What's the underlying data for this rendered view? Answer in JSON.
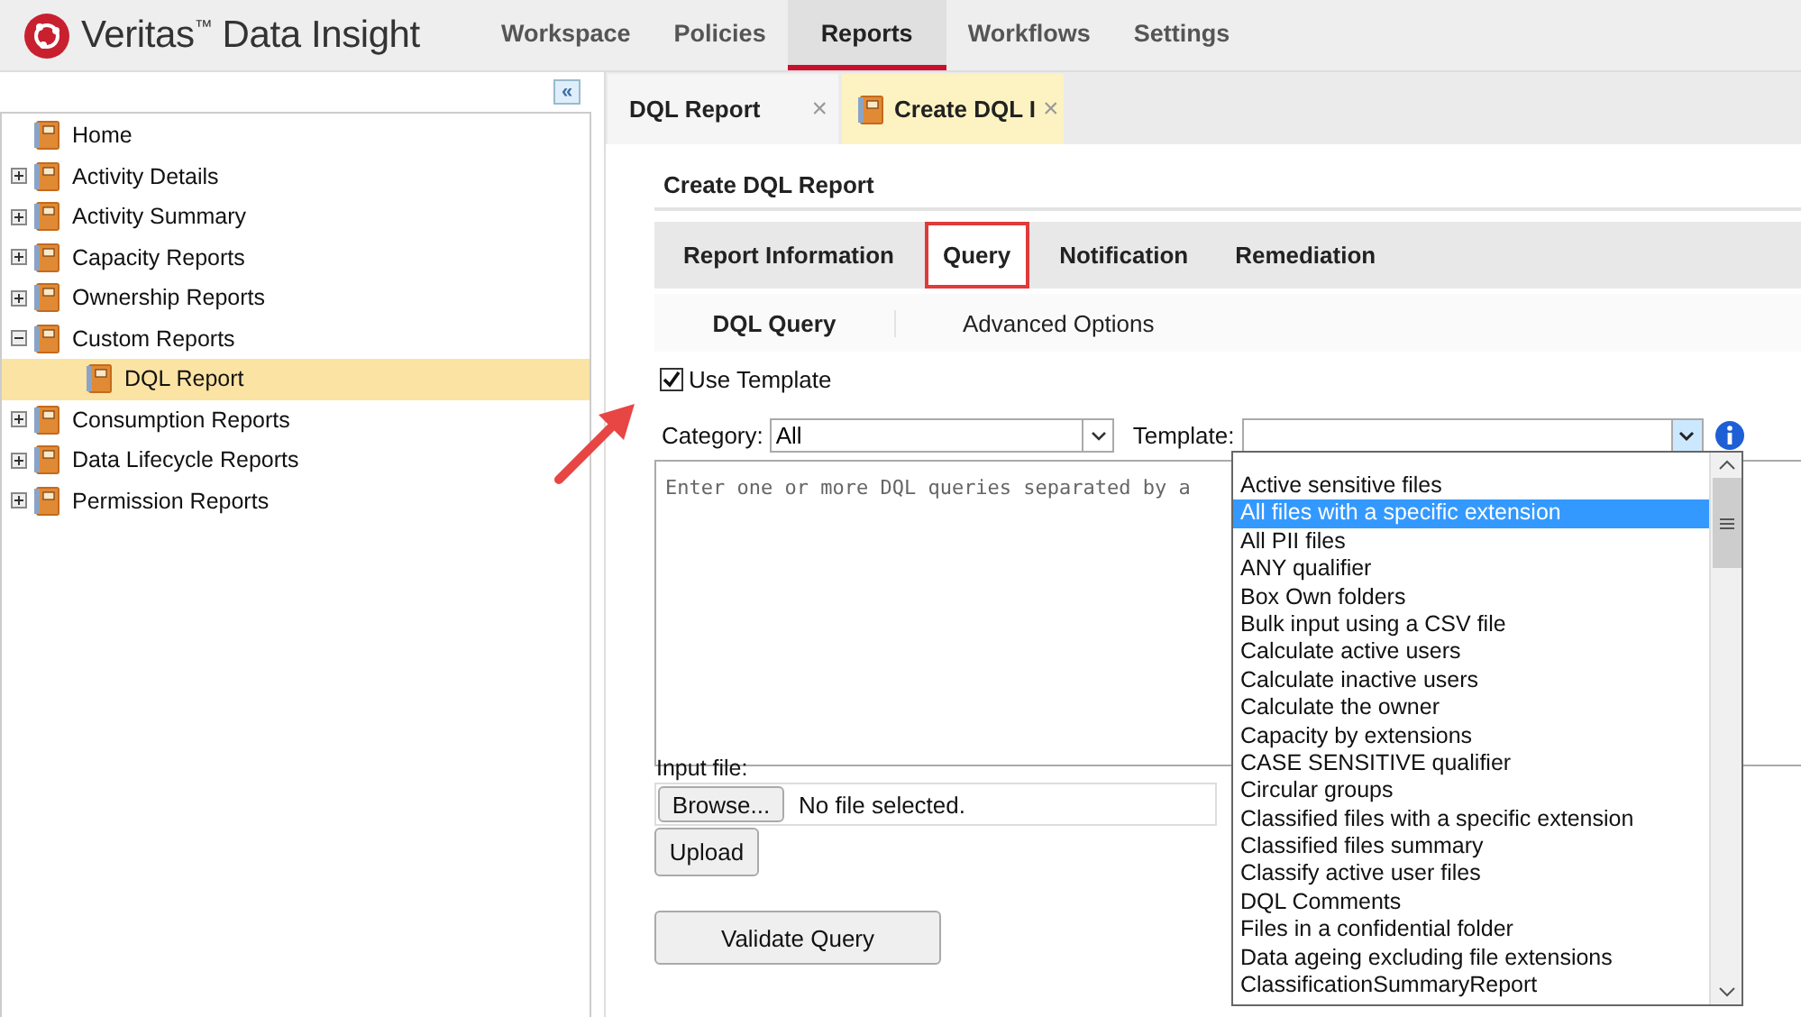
{
  "header": {
    "brand": "Veritas$^{™}$ Data Insight",
    "nav": [
      {
        "label": "Workspace",
        "selected": false
      },
      {
        "label": "Policies",
        "selected": false
      },
      {
        "label": "Reports",
        "selected": true
      },
      {
        "label": "Workflows",
        "selected": false
      },
      {
        "label": "Settings",
        "selected": false
      }
    ]
  },
  "sidebar": {
    "collapse_label": "«",
    "tree": [
      {
        "label": "Home",
        "selected": false
      },
      {
        "label": "Activity Details",
        "kind": "folder",
        "expanded": false,
        "selected": false
      },
      {
        "label": "Activity Summary",
        "kind": "folder",
        "expanded": false,
        "selected": false
      },
      {
        "label": "Capacity Reports",
        "kind": "folder",
        "expanded": false,
        "selected": false
      },
      {
        "label": "Ownership Reports",
        "kind": "folder",
        "expanded": false,
        "selected": false
      },
      {
        "label": "Custom Reports",
        "kind": "folder",
        "expanded": true,
        "selected": false,
        "children": [
          {
            "label": "DQL Report",
            "selected": true
          }
        ]
      },
      {
        "label": "Consumption Reports",
        "kind": "folder",
        "expanded": false,
        "selected": false
      },
      {
        "label": "Data Lifecycle Reports",
        "kind": "folder",
        "expanded": false,
        "selected": false
      },
      {
        "label": "Permission Reports",
        "kind": "folder",
        "expanded": false,
        "selected": false
      }
    ]
  },
  "doc_tabs": [
    {
      "label": "DQL Report",
      "selected": false,
      "icon": false,
      "close": "×"
    },
    {
      "label": "Create DQL I",
      "selected": true,
      "icon": true,
      "close": "×"
    }
  ],
  "form": {
    "title": "Create DQL Report",
    "tabs": [
      {
        "label": "Report Information",
        "selected": false
      },
      {
        "label": "Query",
        "selected": true
      },
      {
        "label": "Notification",
        "selected": false
      },
      {
        "label": "Remediation",
        "selected": false
      }
    ],
    "subtabs": [
      {
        "label": "DQL Query",
        "selected": true
      },
      {
        "label": "Advanced Options",
        "selected": false
      }
    ],
    "use_template": {
      "label": "Use Template",
      "checked": true
    },
    "category": {
      "label": "Category:",
      "value": "All"
    },
    "template": {
      "label": "Template:"
    },
    "query_placeholder": "Enter one or more DQL queries separated by a",
    "input_file_label": "Input file:",
    "browse": "Browse...",
    "file_status": "No file selected.",
    "upload": "Upload",
    "validate": "Validate Query",
    "template_options": [
      {
        "label": "Active sensitive files",
        "selected": false
      },
      {
        "label": "All files with a specific extension",
        "selected": true
      },
      {
        "label": "All PII files",
        "selected": false
      },
      {
        "label": "ANY qualifier",
        "selected": false
      },
      {
        "label": "Box Own folders",
        "selected": false
      },
      {
        "label": "Bulk input using a CSV file",
        "selected": false
      },
      {
        "label": "Calculate active users",
        "selected": false
      },
      {
        "label": "Calculate inactive users",
        "selected": false
      },
      {
        "label": "Calculate the owner",
        "selected": false
      },
      {
        "label": "Capacity by extensions",
        "selected": false
      },
      {
        "label": "CASE SENSITIVE qualifier",
        "selected": false
      },
      {
        "label": "Circular groups",
        "selected": false
      },
      {
        "label": "Classified files with a specific extension",
        "selected": false
      },
      {
        "label": "Classified files summary",
        "selected": false
      },
      {
        "label": "Classify active user files",
        "selected": false
      },
      {
        "label": "DQL Comments",
        "selected": false
      },
      {
        "label": "Files in a confidential folder",
        "selected": false
      },
      {
        "label": "Data ageing excluding file extensions",
        "selected": false
      },
      {
        "label": "ClassificationSummaryReport",
        "selected": false
      }
    ]
  }
}
